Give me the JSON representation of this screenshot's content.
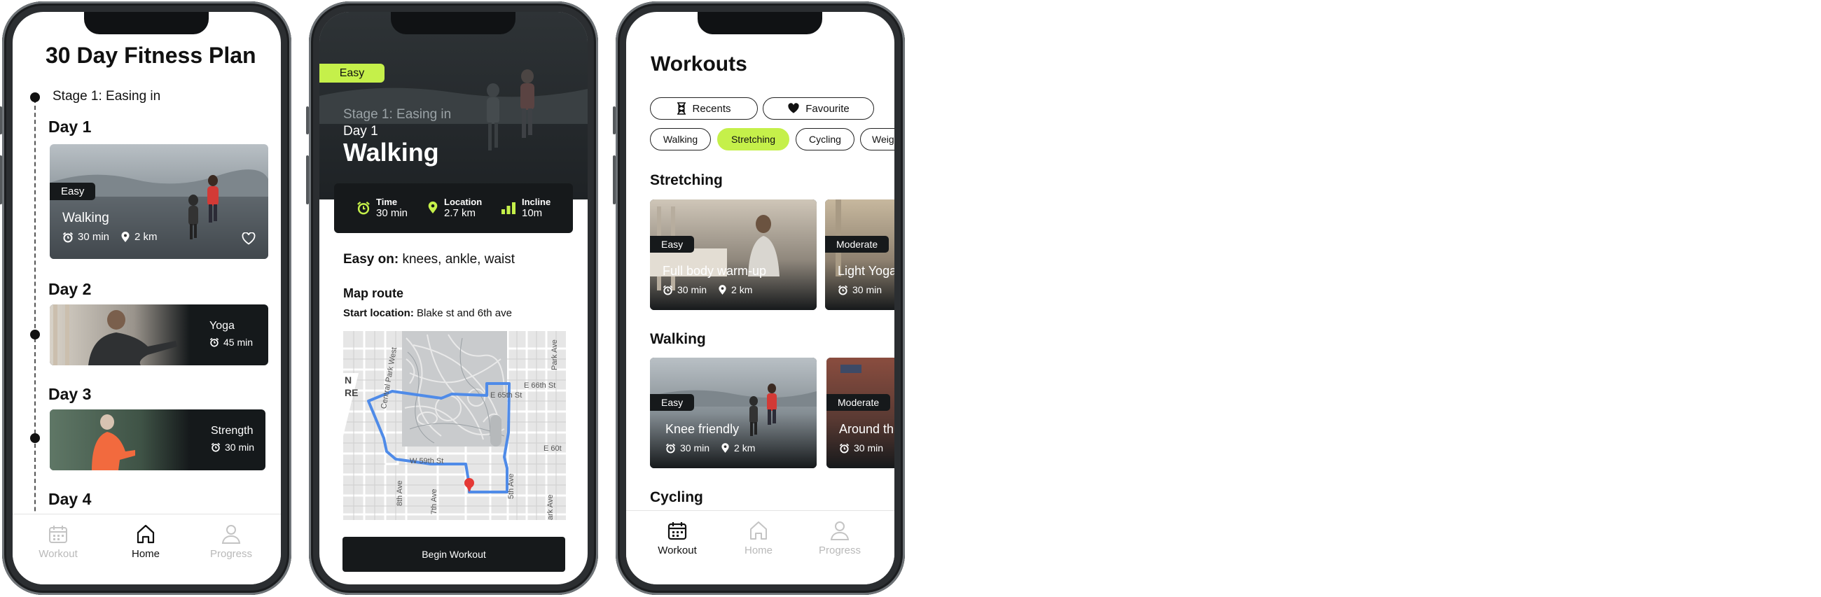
{
  "screen1": {
    "title": "30 Day Fitness Plan",
    "stage": "Stage 1: Easing in",
    "days": [
      {
        "label": "Day 1",
        "badge": "Easy",
        "name": "Walking",
        "time": "30 min",
        "distance": "2 km"
      },
      {
        "label": "Day 2",
        "name": "Yoga",
        "time": "45 min"
      },
      {
        "label": "Day 3",
        "name": "Strength",
        "time": "30 min"
      },
      {
        "label": "Day 4"
      }
    ],
    "tabs": [
      "Workout",
      "Home",
      "Progress"
    ]
  },
  "screen2": {
    "badge": "Easy",
    "stage": "Stage 1: Easing in",
    "day": "Day 1",
    "title": "Walking",
    "stats": [
      {
        "label": "Time",
        "value": "30 min"
      },
      {
        "label": "Location",
        "value": "2.7 km"
      },
      {
        "label": "Incline",
        "value": "10m"
      }
    ],
    "easy_on_label": "Easy on:",
    "easy_on_value": " knees, ankle, waist",
    "map_title": "Map route",
    "start_label": "Start location:",
    "start_value": " Blake st and 6th ave",
    "streets": [
      "Central Park West",
      "E 66th St",
      "E 65th St",
      "E 60t",
      "W 59th St",
      "8th Ave",
      "7th Ave",
      "5th Ave",
      "Park Ave",
      "ark Ave",
      "N",
      "RE"
    ],
    "begin_button": "Begin Workout"
  },
  "screen3": {
    "title": "Workouts",
    "chips_row1": [
      "Recents",
      "Favourite"
    ],
    "chips_row2": [
      "Walking",
      "Stretching",
      "Cycling",
      "Weig"
    ],
    "sections": [
      {
        "title": "Stretching",
        "cards": [
          {
            "badge": "Easy",
            "name": "Full body warm-up",
            "time": "30 min",
            "distance": "2 km"
          },
          {
            "badge": "Moderate",
            "name": "Light Yoga",
            "time": "30 min"
          }
        ]
      },
      {
        "title": "Walking",
        "cards": [
          {
            "badge": "Easy",
            "name": "Knee friendly",
            "time": "30 min",
            "distance": "2 km"
          },
          {
            "badge": "Moderate",
            "name": "Around th",
            "time": "30 min"
          }
        ]
      },
      {
        "title": "Cycling"
      }
    ],
    "tabs": [
      "Workout",
      "Home",
      "Progress"
    ]
  },
  "colors": {
    "accent": "#c5f04a",
    "dark": "#16191b",
    "route": "#4f8be8",
    "pin": "#e53935"
  }
}
